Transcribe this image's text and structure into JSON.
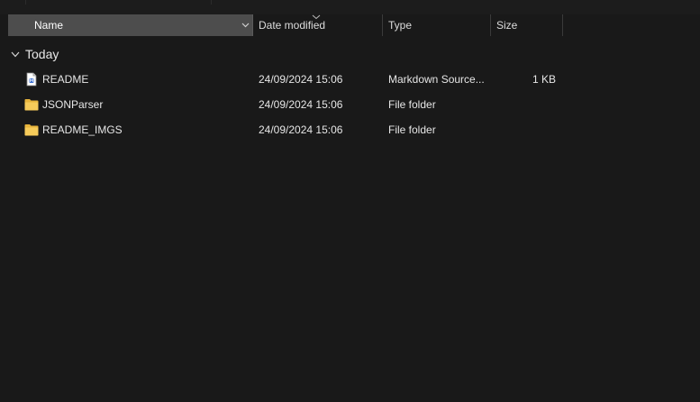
{
  "columns": {
    "name": "Name",
    "date_modified": "Date modified",
    "type": "Type",
    "size": "Size"
  },
  "group": {
    "label": "Today"
  },
  "files": [
    {
      "name": "README",
      "date": "24/09/2024 15:06",
      "type": "Markdown Source...",
      "size": "1 KB",
      "icon": "markdown-file-icon"
    },
    {
      "name": "JSONParser",
      "date": "24/09/2024 15:06",
      "type": "File folder",
      "size": "",
      "icon": "folder-icon"
    },
    {
      "name": "README_IMGS",
      "date": "24/09/2024 15:06",
      "type": "File folder",
      "size": "",
      "icon": "folder-icon"
    }
  ],
  "colors": {
    "background": "#191919",
    "header_selected": "#4d4d4d",
    "folder": "#f3c652",
    "text": "#e6e6e6"
  }
}
